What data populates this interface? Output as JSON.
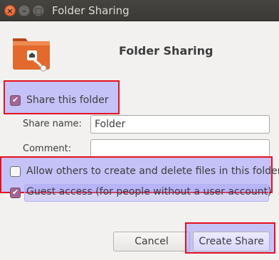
{
  "window": {
    "title": "Folder Sharing",
    "close_glyph": "×",
    "min_glyph": "–",
    "max_glyph": "□"
  },
  "header": {
    "icon": "folder-share-icon",
    "title": "Folder Sharing"
  },
  "share": {
    "label": "Share this folder",
    "checked": true
  },
  "fields": {
    "share_name_label": "Share name:",
    "share_name_value": "Folder",
    "comment_label": "Comment:",
    "comment_value": ""
  },
  "options": {
    "allow_others_label": "Allow others to create and delete files in this folder",
    "allow_others_checked": false,
    "guest_label": "Guest access (for people without a user account)",
    "guest_checked": true
  },
  "buttons": {
    "cancel": "Cancel",
    "create": "Create Share"
  },
  "colors": {
    "highlight_border": "#e5101e",
    "highlight_fill": "#a09bff",
    "checkbox_checked": "#a36591",
    "folder_orange": "#e26a2c"
  }
}
